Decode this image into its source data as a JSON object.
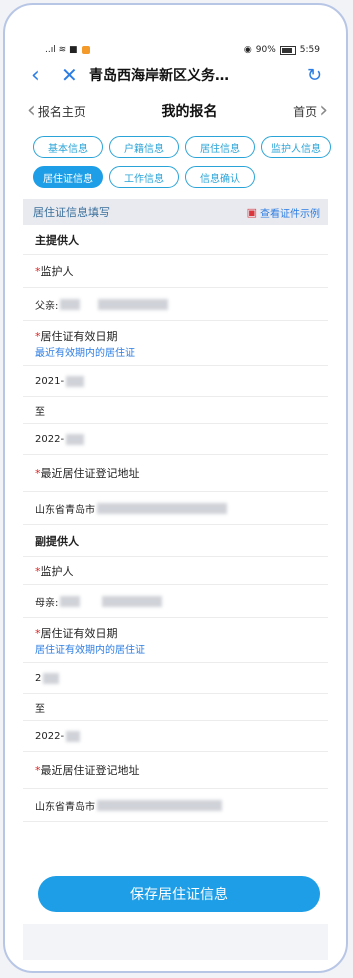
{
  "status_bar": {
    "left_text": "..ıl  ≋  ■",
    "battery": "90%",
    "time": "5:59"
  },
  "topbar": {
    "title": "青岛西海岸新区义务…"
  },
  "nav": {
    "left": "报名主页",
    "center": "我的报名",
    "right": "首页"
  },
  "tabs": [
    {
      "label": "基本信息",
      "active": false
    },
    {
      "label": "户籍信息",
      "active": false
    },
    {
      "label": "居住信息",
      "active": false
    },
    {
      "label": "监护人信息",
      "active": false
    },
    {
      "label": "居住证信息",
      "active": true
    },
    {
      "label": "工作信息",
      "active": false
    },
    {
      "label": "信息确认",
      "active": false
    }
  ],
  "section": {
    "title": "居住证信息填写",
    "example": "查看证件示例"
  },
  "primary": {
    "group": "主提供人",
    "guardian_label": "监护人",
    "guardian_value": "父亲:",
    "permit_label": "居住证有效日期",
    "permit_hint": "最近有效期内的居住证",
    "start": "2021-",
    "to": "至",
    "end": "2022-",
    "addr_label": "最近居住证登记地址",
    "addr_value": "山东省青岛市"
  },
  "secondary": {
    "group": "副提供人",
    "guardian_label": "监护人",
    "guardian_value": "母亲:",
    "permit_label": "居住证有效日期",
    "permit_hint": "居住证有效期内的居住证",
    "start": "2",
    "to": "至",
    "end": "2022-",
    "addr_label": "最近居住证登记地址",
    "addr_value": "山东省青岛市"
  },
  "save_button": "保存居住证信息"
}
